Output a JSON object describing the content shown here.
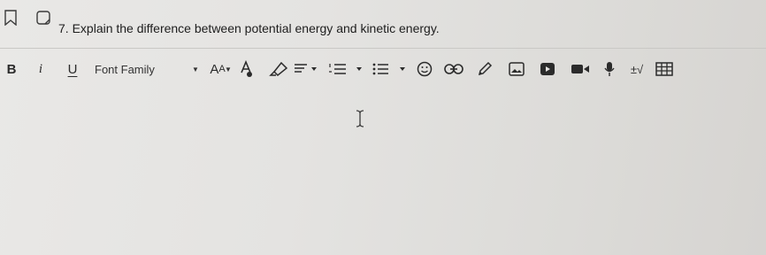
{
  "question": {
    "number": "7.",
    "text": "Explain the difference between potential energy and kinetic energy."
  },
  "toolbar": {
    "bold_label": "B",
    "italic_label": "i",
    "underline_label": "U",
    "font_family": {
      "selected": "Font Family"
    },
    "font_size_label_big": "A",
    "font_size_label_small": "A"
  },
  "icons": {
    "question-row": [
      "bookmark-icon",
      "flag-icon"
    ],
    "toolbar": [
      "font-color-icon",
      "highlighter-icon",
      "align-icon",
      "numbered-list-icon",
      "bulleted-list-icon",
      "emoji-icon",
      "link-icon",
      "pencil-icon",
      "image-icon",
      "video-icon",
      "record-video-icon",
      "microphone-icon",
      "math-icon",
      "table-icon"
    ],
    "editor": [
      "text-cursor-icon"
    ]
  },
  "math_symbol": "±√",
  "colors": {
    "background": "#e4e3e1",
    "text": "#1e1e1e",
    "icon": "#2b2b2b"
  }
}
